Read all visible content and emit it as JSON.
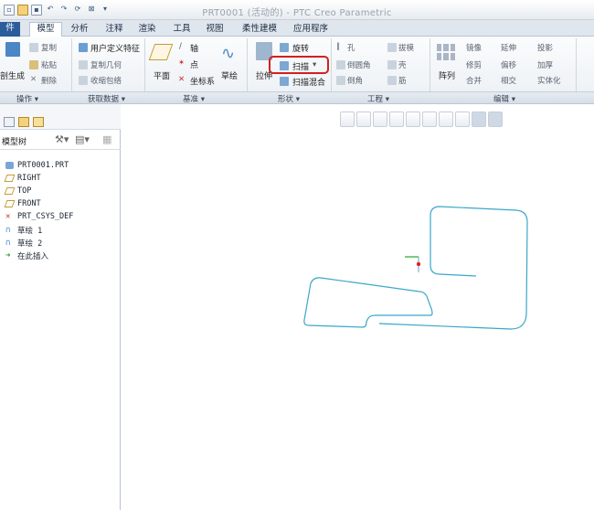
{
  "window": {
    "title": "PRT0001 (活动的) - PTC Creo Parametric"
  },
  "tabs": [
    {
      "label": "件"
    },
    {
      "label": "模型"
    },
    {
      "label": "分析"
    },
    {
      "label": "注释"
    },
    {
      "label": "渲染"
    },
    {
      "label": "工具"
    },
    {
      "label": "视图"
    },
    {
      "label": "柔性建模"
    },
    {
      "label": "应用程序"
    }
  ],
  "ribbon": {
    "operations": {
      "regenerate": "剖生成",
      "copy": "复制",
      "paste": "粘贴",
      "delete": "删除"
    },
    "get_data": {
      "udf": "用户定义特征",
      "copy_geom": "复制几何",
      "shrinkwrap": "收缩包络"
    },
    "datum": {
      "plane": "平面",
      "axis": "轴",
      "point": "点",
      "csys": "坐标系",
      "sketch": "草绘"
    },
    "shapes": {
      "extrude": "拉伸",
      "revolve": "旋转",
      "sweep": "扫描",
      "swept_blend": "扫描混合"
    },
    "engineering": {
      "hole": "孔",
      "round": "倒圆角",
      "chamfer": "倒角",
      "draft": "拔模",
      "shell": "壳",
      "rib": "筋"
    },
    "editing": {
      "pattern": "阵列",
      "mirror": "镜像",
      "trim": "修剪",
      "merge": "合并",
      "extend": "延伸",
      "offset": "偏移",
      "intersect": "相交",
      "project": "投影",
      "thicken": "加厚",
      "solidify": "实体化"
    },
    "groups": {
      "operations": "操作",
      "get_data": "获取数据",
      "datum": "基准",
      "shapes": "形状",
      "engineering": "工程",
      "editing": "编辑"
    }
  },
  "model_tree": {
    "title": "模型树",
    "items": [
      {
        "label": "PRT0001.PRT",
        "icon": "part-icon"
      },
      {
        "label": "RIGHT",
        "icon": "datum-plane-icon"
      },
      {
        "label": "TOP",
        "icon": "datum-plane-icon"
      },
      {
        "label": "FRONT",
        "icon": "datum-plane-icon"
      },
      {
        "label": "PRT_CSYS_DEF",
        "icon": "csys-icon"
      },
      {
        "label": "草绘 1",
        "icon": "sketch-icon"
      },
      {
        "label": "草绘 2",
        "icon": "sketch-icon"
      },
      {
        "label": "在此插入",
        "icon": "insert-arrow-icon"
      }
    ]
  },
  "colors": {
    "accent": "#2b5d9a",
    "highlight_box": "#d22020",
    "sketch_curve": "#3aa7c9",
    "csys_x": "#22aa22",
    "csys_origin": "#dd2222"
  }
}
